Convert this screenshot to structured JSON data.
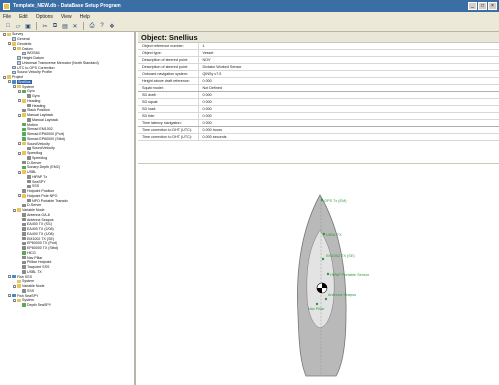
{
  "window": {
    "title": "Template_NEW.db - DataBase Setup Program",
    "controls": [
      "_",
      "□",
      "×"
    ]
  },
  "menu": [
    "File",
    "Edit",
    "Options",
    "View",
    "Help"
  ],
  "toolbar": {
    "buttons": [
      "new-icon",
      "open-icon",
      "save-icon",
      "cut-icon",
      "copy-icon",
      "paste-icon",
      "delete-icon",
      "print-icon",
      "help-icon",
      "about-icon"
    ]
  },
  "tree": [
    {
      "label": "Survey",
      "depth": 0,
      "exp": "-",
      "icon": "folder"
    },
    {
      "label": "General",
      "depth": 1,
      "exp": "",
      "icon": "doc"
    },
    {
      "label": "Geodetic",
      "depth": 1,
      "exp": "-",
      "icon": "folder"
    },
    {
      "label": "Datum",
      "depth": 2,
      "exp": "-",
      "icon": "folder"
    },
    {
      "label": "WGS84",
      "depth": 3,
      "exp": "",
      "icon": "doc"
    },
    {
      "label": "Height Datum",
      "depth": 2,
      "exp": "",
      "icon": "doc"
    },
    {
      "label": "Universal Transverse Mercator (North Standard)",
      "depth": 2,
      "exp": "",
      "icon": "doc"
    },
    {
      "label": "UTC to GPS Correction",
      "depth": 1,
      "exp": "",
      "icon": "doc"
    },
    {
      "label": "Sound Velocity Profile",
      "depth": 1,
      "exp": "",
      "icon": "doc"
    },
    {
      "label": "Project",
      "depth": 0,
      "exp": "-",
      "icon": "folder"
    },
    {
      "label": "Snellius",
      "depth": 1,
      "exp": "-",
      "icon": "vessel",
      "selected": true
    },
    {
      "label": "System",
      "depth": 2,
      "exp": "-",
      "icon": "folder"
    },
    {
      "label": "Gyro",
      "depth": 3,
      "exp": "-",
      "icon": "sensor"
    },
    {
      "label": "Gyro",
      "depth": 4,
      "exp": "",
      "icon": "gear"
    },
    {
      "label": "Heading",
      "depth": 3,
      "exp": "-",
      "icon": "folder"
    },
    {
      "label": "Heading",
      "depth": 4,
      "exp": "",
      "icon": "gear"
    },
    {
      "label": "Stack Position",
      "depth": 3,
      "exp": "",
      "icon": "gear"
    },
    {
      "label": "Manual Layback",
      "depth": 3,
      "exp": "-",
      "icon": "folder"
    },
    {
      "label": "Manual Layback",
      "depth": 4,
      "exp": "",
      "icon": "gear"
    },
    {
      "label": "Motion",
      "depth": 3,
      "exp": "",
      "icon": "sensor"
    },
    {
      "label": "Simrad EM1002",
      "depth": 3,
      "exp": "",
      "icon": "sensor"
    },
    {
      "label": "Simrad EP60000 (Port)",
      "depth": 3,
      "exp": "",
      "icon": "sensor"
    },
    {
      "label": "Simrad EP60000 (Stbd)",
      "depth": 3,
      "exp": "",
      "icon": "sensor"
    },
    {
      "label": "SoundVelocity",
      "depth": 3,
      "exp": "-",
      "icon": "folder"
    },
    {
      "label": "SoundVelocity",
      "depth": 4,
      "exp": "",
      "icon": "gear"
    },
    {
      "label": "Speedlog",
      "depth": 3,
      "exp": "-",
      "icon": "folder"
    },
    {
      "label": "Speedlog",
      "depth": 4,
      "exp": "",
      "icon": "gear"
    },
    {
      "label": "D-Server",
      "depth": 3,
      "exp": "",
      "icon": "gear"
    },
    {
      "label": "Sonarp Depth (EM2)",
      "depth": 3,
      "exp": "",
      "icon": "sensor"
    },
    {
      "label": "USBL",
      "depth": 3,
      "exp": "-",
      "icon": "folder"
    },
    {
      "label": "HiPAP Tx",
      "depth": 4,
      "exp": "",
      "icon": "gear"
    },
    {
      "label": "SeaSPY",
      "depth": 4,
      "exp": "",
      "icon": "gear"
    },
    {
      "label": "SSS",
      "depth": 4,
      "exp": "",
      "icon": "gear"
    },
    {
      "label": "Hotpoint Position",
      "depth": 3,
      "exp": "",
      "icon": "gear"
    },
    {
      "label": "Hotpoint Pole NPO",
      "depth": 3,
      "exp": "-",
      "icon": "folder"
    },
    {
      "label": "NPO Portable Transdx",
      "depth": 4,
      "exp": "",
      "icon": "gear"
    },
    {
      "label": "D-Server",
      "depth": 3,
      "exp": "",
      "icon": "gear"
    },
    {
      "label": "Variable Node",
      "depth": 2,
      "exp": "-",
      "icon": "folder"
    },
    {
      "label": "Antenna GA-8",
      "depth": 3,
      "exp": "",
      "icon": "gear"
    },
    {
      "label": "Antenna Seapos",
      "depth": 3,
      "exp": "",
      "icon": "gear"
    },
    {
      "label": "EA400 TX (S/1)",
      "depth": 3,
      "exp": "",
      "icon": "gear"
    },
    {
      "label": "EA400 TX (2/08)",
      "depth": 3,
      "exp": "",
      "icon": "gear"
    },
    {
      "label": "EA400 TX (1/08)",
      "depth": 3,
      "exp": "",
      "icon": "gear"
    },
    {
      "label": "EM1002 TX (SE)",
      "depth": 3,
      "exp": "",
      "icon": "gear"
    },
    {
      "label": "EP60000 TX (Port)",
      "depth": 3,
      "exp": "",
      "icon": "gear"
    },
    {
      "label": "EP60000 TX (Stbd)",
      "depth": 3,
      "exp": "",
      "icon": "gear"
    },
    {
      "label": "HiCG",
      "depth": 3,
      "exp": "",
      "icon": "sensor"
    },
    {
      "label": "Nav Pillar",
      "depth": 3,
      "exp": "",
      "icon": "gear"
    },
    {
      "label": "Pillbar Hotpoint",
      "depth": 3,
      "exp": "",
      "icon": "gear"
    },
    {
      "label": "Towpoint SSS",
      "depth": 3,
      "exp": "",
      "icon": "gear"
    },
    {
      "label": "USBL TX",
      "depth": 3,
      "exp": "",
      "icon": "gear"
    },
    {
      "label": "Fish SSS",
      "depth": 1,
      "exp": "-",
      "icon": "vessel"
    },
    {
      "label": "System",
      "depth": 2,
      "exp": "",
      "icon": "folder"
    },
    {
      "label": "Variable Node",
      "depth": 2,
      "exp": "-",
      "icon": "folder"
    },
    {
      "label": "SSS",
      "depth": 3,
      "exp": "",
      "icon": "gear"
    },
    {
      "label": "Fish SeaSPY",
      "depth": 1,
      "exp": "-",
      "icon": "vessel"
    },
    {
      "label": "System",
      "depth": 2,
      "exp": "-",
      "icon": "folder"
    },
    {
      "label": "Depth SeaSPY",
      "depth": 3,
      "exp": "",
      "icon": "sensor"
    }
  ],
  "main": {
    "title": "Object: Snellius",
    "properties": [
      {
        "key": "Object reference number:",
        "value": "1"
      },
      {
        "key": "Object type:",
        "value": "Vessel"
      },
      {
        "key": "Description of steered point:",
        "value": "NOV"
      },
      {
        "key": "Description of steered point:",
        "value": "Dictator Worked Sensor"
      },
      {
        "key": "Onboard navigation system:",
        "value": "QINSy v7.5"
      },
      {
        "key": "Height above draft reference:",
        "value": "0.000"
      },
      {
        "key": "Squat model:",
        "value": "Not Defined",
        "sep": true
      },
      {
        "key": "SD draft:",
        "value": "0.000"
      },
      {
        "key": "SD squat:",
        "value": "0.000"
      },
      {
        "key": "SD load:",
        "value": "0.000"
      },
      {
        "key": "SD tide:",
        "value": "0.000"
      },
      {
        "key": "Time latency navigation:",
        "value": "0.000",
        "sep": true
      },
      {
        "key": "Time correction to DHT (UTC):",
        "value": "0.000 hours"
      },
      {
        "key": "Time correction to DHT (UTC):",
        "value": "0.000 seconds"
      }
    ],
    "drawing_labels": [
      {
        "text": "GPS Tx (EM)"
      },
      {
        "text": "USBL TX"
      },
      {
        "text": "EM1002 TX (SE)"
      },
      {
        "text": "HiPAP Portable Sensor"
      },
      {
        "text": "Antenna Seapos"
      },
      {
        "text": "Nav Pillar"
      }
    ]
  },
  "colors": {
    "hull_outer": "#b9b9b9",
    "hull_inner": "#e3e3e3",
    "hull_edge": "#777777",
    "label_green": "#2e9a3c",
    "selection": "#2b5fa8",
    "titlebar": "#3a6ea5"
  }
}
